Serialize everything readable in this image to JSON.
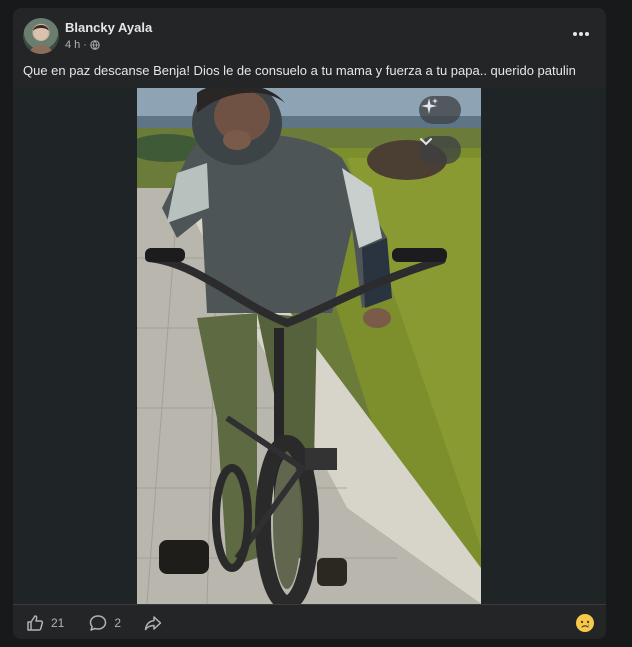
{
  "post": {
    "author": "Blancky Ayala",
    "time": "4 h",
    "caption": "Que en paz descanse Benja! Dios le de consuelo a tu mama y fuerza a tu papa.. querido patulin"
  },
  "footer": {
    "likes_count": "21",
    "comments_count": "2"
  },
  "icons": {
    "more": "more-options-icon",
    "globe": "globe-icon",
    "sparkle": "sparkle-icon",
    "chevron": "chevron-down-icon",
    "like": "thumbs-up-icon",
    "comment": "comment-icon",
    "share": "share-icon",
    "reaction": "sad-reaction-icon"
  },
  "colors": {
    "background": "#18191a",
    "card": "#242526",
    "text": "#e4e6eb",
    "muted": "#b0b3b8",
    "reaction": "#f7c948"
  }
}
